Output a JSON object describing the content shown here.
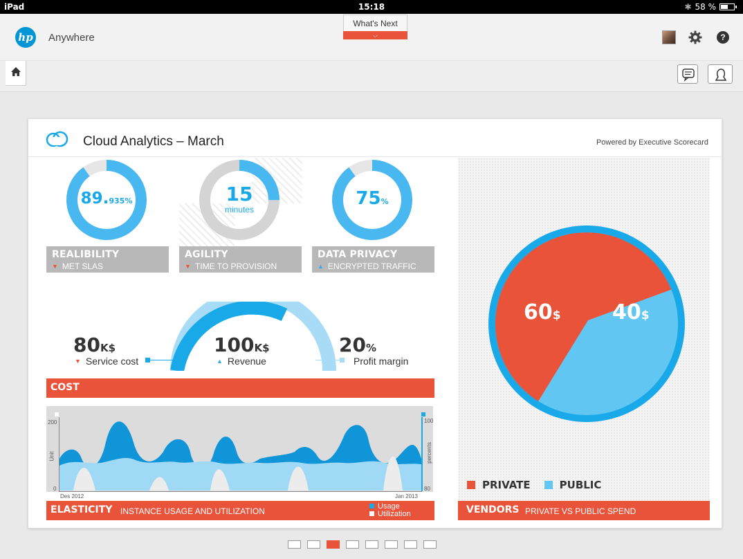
{
  "status_bar": {
    "device": "iPad",
    "time": "15:18",
    "battery": "58 %",
    "battery_level": 0.58
  },
  "header": {
    "logo_text": "hp",
    "app_name": "Anywhere"
  },
  "whats_next": {
    "label": "What's Next"
  },
  "card": {
    "title": "Cloud Analytics – March",
    "powered_by": "Powered by Executive Scorecard"
  },
  "kpis": [
    {
      "value": "89.",
      "decimals": "935",
      "unit": "%",
      "title": "REALIBILITY",
      "subtitle": "MET SLAS",
      "trend": "down",
      "fill": 0.9
    },
    {
      "value": "15",
      "unit": "minutes",
      "title": "AGILITY",
      "subtitle": "TIME TO PROVISION",
      "trend": "down",
      "fill": 0.25
    },
    {
      "value": "75",
      "unit": "%",
      "title": "DATA PRIVACY",
      "subtitle": "ENCRYPTED TRAFFIC",
      "trend": "up",
      "fill": 0.9
    }
  ],
  "cost": {
    "service_cost": {
      "value": "80",
      "unit": "K$",
      "label": "Service cost",
      "trend": "down"
    },
    "revenue": {
      "value": "100",
      "unit": "K$",
      "label": "Revenue",
      "trend": "up"
    },
    "profit_margin": {
      "value": "20",
      "unit": "%",
      "label": "Profit margin"
    },
    "section_title": "COST"
  },
  "elasticity": {
    "title": "ELASTICITY",
    "subtitle": "INSTANCE USAGE AND UTILIZATION",
    "y_left_label": "Unit",
    "y_right_label": "percents",
    "y_left_ticks": [
      "200",
      "0"
    ],
    "y_right_ticks": [
      "100",
      "80"
    ],
    "x_start": "Des 2012",
    "x_end": "Jan 2013",
    "legend_usage": "Usage",
    "legend_utilization": "Utilization"
  },
  "vendors": {
    "title": "VENDORS",
    "subtitle": "PRIVATE VS PUBLIC SPEND",
    "private_value": "60",
    "public_value": "40",
    "unit": "$",
    "private_label": "PRIVATE",
    "public_label": "PUBLIC"
  },
  "colors": {
    "accent": "#e8533a",
    "blue": "#1aa9e8",
    "light_blue": "#62c6f2",
    "gray": "#b8b8b8"
  },
  "pager": {
    "pages": 8,
    "active_index": 2
  },
  "icons": [
    "home-icon",
    "cloud-icon",
    "gear-icon",
    "help-icon",
    "message-icon",
    "user-icon",
    "bluetooth-icon",
    "battery-icon"
  ]
}
